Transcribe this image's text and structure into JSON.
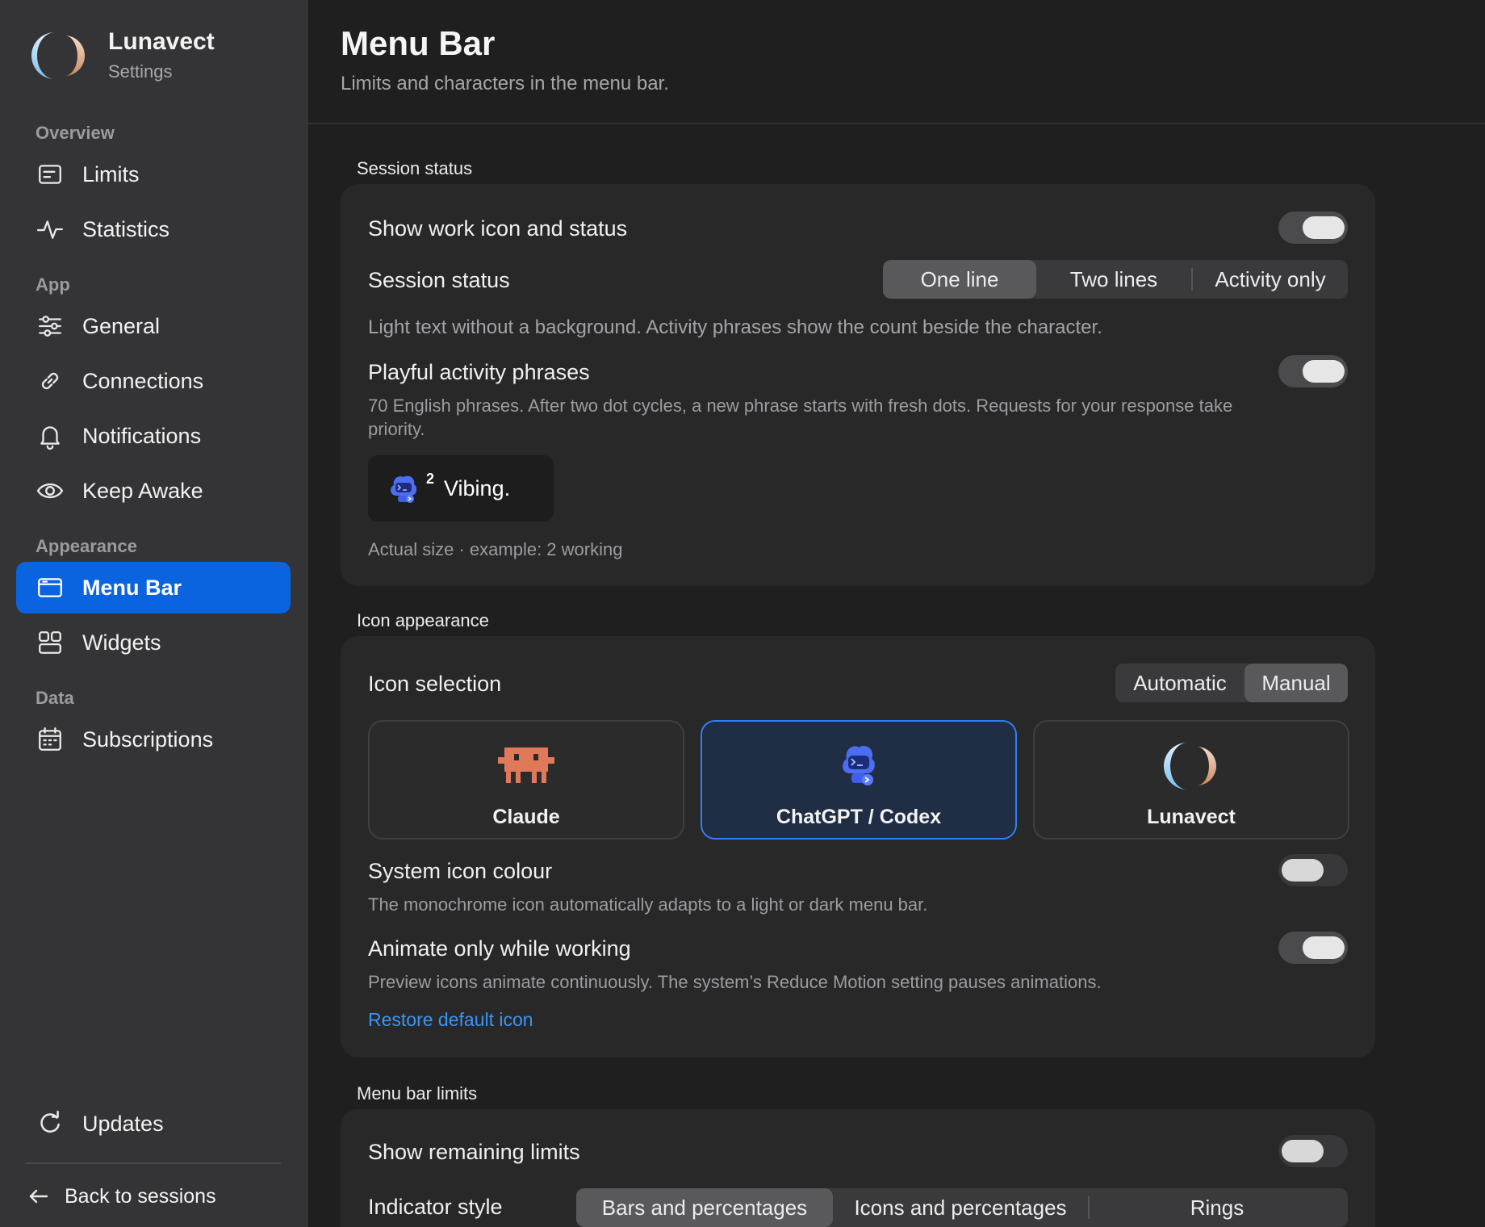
{
  "app": {
    "name": "Lunavect",
    "subtitle": "Settings"
  },
  "sidebar": {
    "sections": {
      "overview": "Overview",
      "app": "App",
      "appearance": "Appearance",
      "data": "Data"
    },
    "items": [
      {
        "label": "Limits",
        "icon": "limits-icon"
      },
      {
        "label": "Statistics",
        "icon": "activity-icon"
      },
      {
        "label": "General",
        "icon": "sliders-icon"
      },
      {
        "label": "Connections",
        "icon": "link-icon"
      },
      {
        "label": "Notifications",
        "icon": "bell-icon"
      },
      {
        "label": "Keep Awake",
        "icon": "eye-icon"
      },
      {
        "label": "Menu Bar",
        "icon": "window-icon",
        "active": true
      },
      {
        "label": "Widgets",
        "icon": "widgets-icon"
      },
      {
        "label": "Subscriptions",
        "icon": "calendar-icon"
      },
      {
        "label": "Updates",
        "icon": "refresh-icon"
      }
    ],
    "back_label": "Back to sessions"
  },
  "header": {
    "title": "Menu Bar",
    "subtitle": "Limits and characters in the menu bar."
  },
  "session_status": {
    "group_title": "Session status",
    "show_work_icon": {
      "label": "Show work icon and status",
      "enabled": true
    },
    "status_mode": {
      "label": "Session status",
      "options": [
        "One line",
        "Two lines",
        "Activity only"
      ],
      "selected": "One line"
    },
    "mode_description": "Light text without a background. Activity phrases show the count beside the character.",
    "playful_phrases": {
      "label": "Playful activity phrases",
      "enabled": true,
      "description": "70 English phrases. After two dot cycles, a new phrase starts with fresh dots. Requests for your response take priority."
    },
    "preview": {
      "count": "2",
      "phrase": "Vibing."
    },
    "preview_caption": "Actual size · example: 2 working"
  },
  "icon_appearance": {
    "group_title": "Icon appearance",
    "icon_selection": {
      "label": "Icon selection",
      "options": [
        "Automatic",
        "Manual"
      ],
      "selected": "Manual"
    },
    "tiles": [
      {
        "label": "Claude",
        "icon": "claude-pixel-icon"
      },
      {
        "label": "ChatGPT / Codex",
        "icon": "codex-robot-icon",
        "selected": true
      },
      {
        "label": "Lunavect",
        "icon": "lunavect-moon-icon"
      }
    ],
    "system_colour": {
      "label": "System icon colour",
      "enabled": false,
      "description": "The monochrome icon automatically adapts to a light or dark menu bar."
    },
    "animate_working": {
      "label": "Animate only while working",
      "enabled": true,
      "description": "Preview icons animate continuously. The system’s Reduce Motion setting pauses animations."
    },
    "restore_link": "Restore default icon"
  },
  "menu_bar_limits": {
    "group_title": "Menu bar limits",
    "show_remaining": {
      "label": "Show remaining limits",
      "enabled": false
    },
    "indicator_style": {
      "label": "Indicator style",
      "options": [
        "Bars and percentages",
        "Icons and percentages",
        "Rings"
      ],
      "selected": "Bars and percentages"
    }
  },
  "colors": {
    "accent": "#0a64e0",
    "link": "#3b94f5",
    "sidebar_bg": "#343436",
    "main_bg": "#1f1f1f",
    "card_bg": "#282829",
    "claude": "#e0785a",
    "codex": "#4d6ef2"
  }
}
